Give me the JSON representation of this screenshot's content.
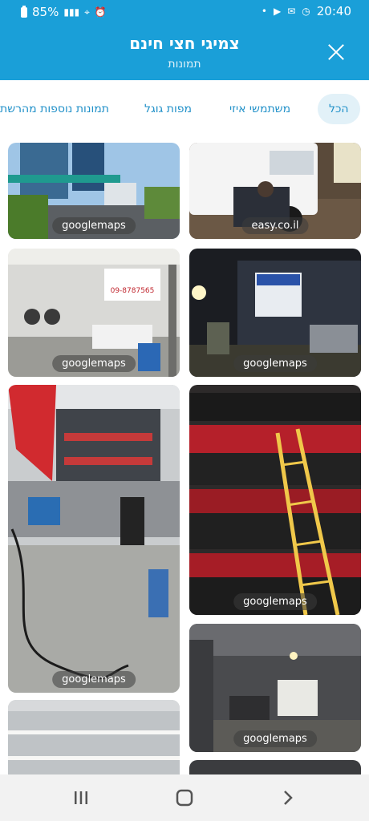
{
  "status_bar": {
    "battery": "85%",
    "time": "20:40"
  },
  "header": {
    "title": "צמיגי חצי חינם",
    "subtitle": "תמונות",
    "close_icon": "close-icon"
  },
  "tabs": [
    "הכל",
    "משתמשי איזי",
    "מפות גוגל",
    "תמונות נוספות מהרשת"
  ],
  "photos": [
    {
      "source": "easy.co.il",
      "scene": "white van with man kneeling at tire"
    },
    {
      "source": "googlemaps",
      "scene": "tower buildings and street"
    },
    {
      "source": "googlemaps",
      "scene": "shop front at night with sign"
    },
    {
      "source": "googlemaps",
      "scene": "workshop interior with sign"
    },
    {
      "source": "googlemaps",
      "scene": "tire racks with yellow ladder"
    },
    {
      "source": "googlemaps",
      "scene": "garage interior with tire stacks"
    },
    {
      "source": "googlemaps",
      "scene": "covered garage with car"
    }
  ],
  "sign_text": "09-8787565",
  "nav": {
    "recents": "recents-icon",
    "home": "home-icon",
    "back": "back-icon"
  }
}
